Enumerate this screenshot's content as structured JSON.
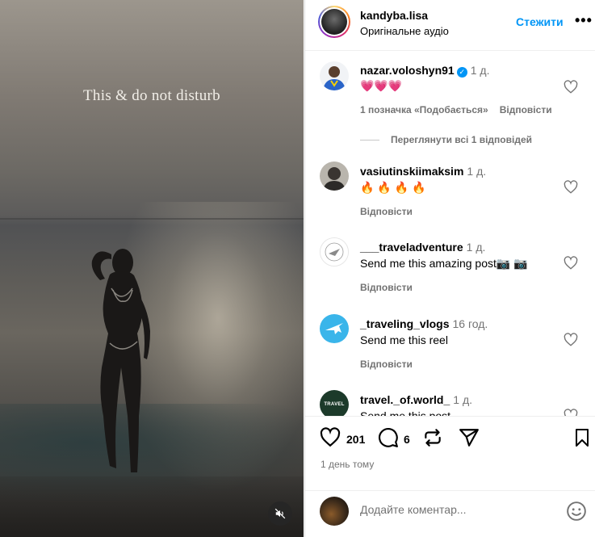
{
  "media": {
    "overlay_text": "This & do not disturb",
    "mute_icon": "speaker-muted-icon"
  },
  "header": {
    "username": "kandyba.lisa",
    "audio": "Оригінальне аудіо",
    "follow_label": "Стежити",
    "more_label": "•••"
  },
  "comments": [
    {
      "username": "nazar.voloshyn91",
      "verified": true,
      "time": "1 д.",
      "text": "💗💗💗",
      "likes": "1 позначка «Подобається»",
      "reply": "Відповісти",
      "view_replies": "Переглянути всі 1 відповідей"
    },
    {
      "username": "vasiutinskiimaksim",
      "time": "1 д.",
      "text": "🔥 🔥 🔥 🔥",
      "reply": "Відповісти"
    },
    {
      "username": "___traveladventure",
      "time": "1 д.",
      "text": "Send me this amazing post📷 📷",
      "reply": "Відповісти"
    },
    {
      "username": "_traveling_vlogs",
      "time": "16 год.",
      "text": "Send me this reel",
      "reply": "Відповісти"
    },
    {
      "username": "travel._of.world_",
      "time": "1 д.",
      "text": "Send me this post",
      "avatar_label": "TRAVEL"
    }
  ],
  "actions": {
    "likes_count": "201",
    "comments_count": "6",
    "date": "1 день тому"
  },
  "add_comment": {
    "placeholder": "Додайте коментар..."
  },
  "colors": {
    "accent": "#0095f6",
    "muted_text": "#737373",
    "heart": "#ed4956"
  }
}
